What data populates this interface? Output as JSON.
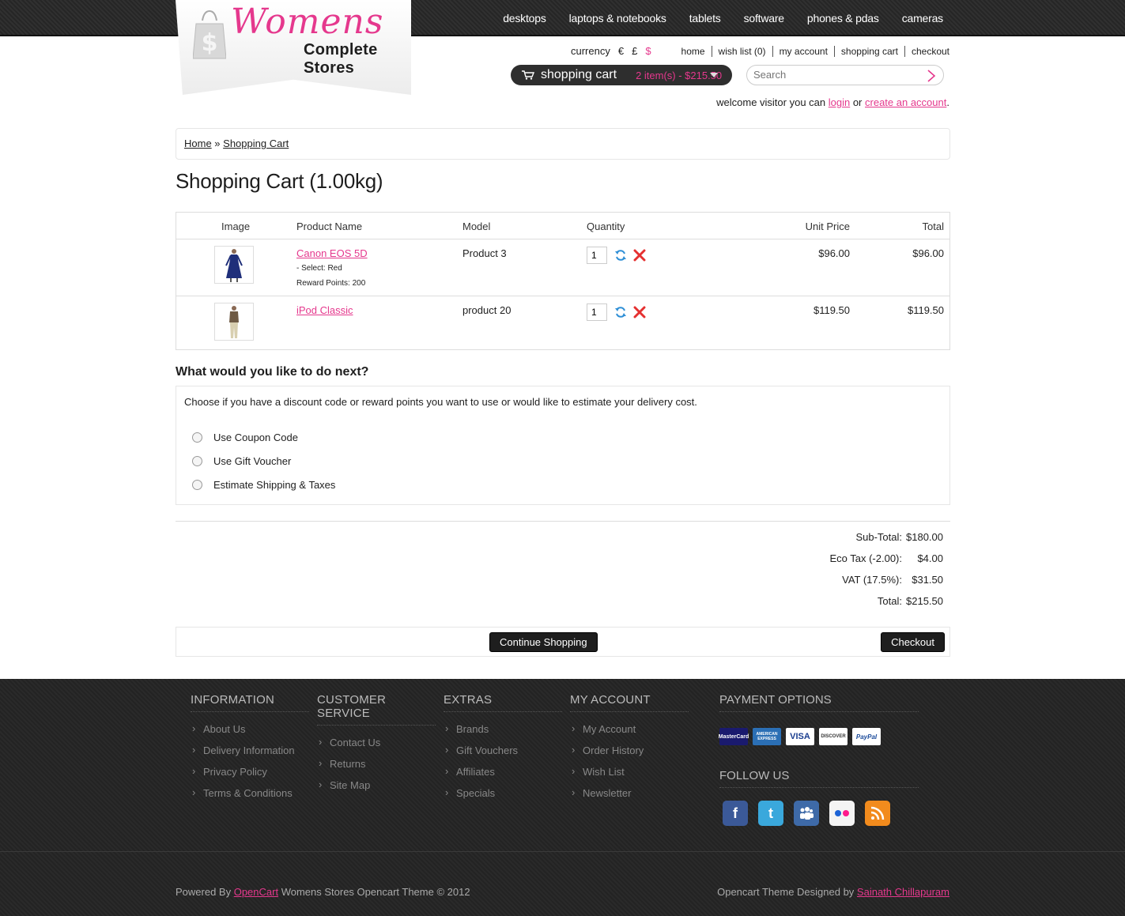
{
  "topnav": [
    "desktops",
    "laptops & notebooks",
    "tablets",
    "software",
    "phones & pdas",
    "cameras"
  ],
  "logo": {
    "brand": "Womens",
    "tagline": "Complete Stores"
  },
  "currency": {
    "label": "currency",
    "options": [
      "€",
      "£",
      "$"
    ],
    "selected": "$"
  },
  "toplinks": [
    "home",
    "wish list (0)",
    "my account",
    "shopping cart",
    "checkout"
  ],
  "cart": {
    "label": "shopping cart",
    "summary": "2 item(s) - $215.50"
  },
  "search": {
    "placeholder": "Search"
  },
  "welcome": {
    "prefix": "welcome visitor you can ",
    "login": "login",
    "or": " or ",
    "create": "create an account",
    "suffix": "."
  },
  "breadcrumb": {
    "home": "Home",
    "sep": " » ",
    "current": "Shopping Cart"
  },
  "page_title": "Shopping Cart  (1.00kg)",
  "table": {
    "headers": {
      "image": "Image",
      "name": "Product Name",
      "model": "Model",
      "quantity": "Quantity",
      "unit": "Unit Price",
      "total": "Total"
    },
    "rows": [
      {
        "name": "Canon EOS 5D",
        "options": [
          "- Select: Red",
          "Reward Points: 200"
        ],
        "model": "Product 3",
        "qty": "1",
        "unit": "$96.00",
        "total": "$96.00"
      },
      {
        "name": "iPod Classic",
        "options": [],
        "model": "product 20",
        "qty": "1",
        "unit": "$119.50",
        "total": "$119.50"
      }
    ]
  },
  "next": {
    "title": "What would you like to do next?",
    "intro": "Choose if you have a discount code or reward points you want to use or would like to estimate your delivery cost.",
    "options": [
      "Use Coupon Code",
      "Use Gift Voucher",
      "Estimate Shipping & Taxes"
    ]
  },
  "totals": [
    {
      "label": "Sub-Total:",
      "value": "$180.00"
    },
    {
      "label": "Eco Tax (-2.00):",
      "value": "$4.00"
    },
    {
      "label": "VAT (17.5%):",
      "value": "$31.50"
    },
    {
      "label": "Total:",
      "value": "$215.50"
    }
  ],
  "buttons": {
    "continue": "Continue Shopping",
    "checkout": "Checkout"
  },
  "footer": {
    "columns": [
      {
        "title": "INFORMATION",
        "items": [
          "About Us",
          "Delivery Information",
          "Privacy Policy",
          "Terms & Conditions"
        ]
      },
      {
        "title": "CUSTOMER SERVICE",
        "items": [
          "Contact Us",
          "Returns",
          "Site Map"
        ]
      },
      {
        "title": "EXTRAS",
        "items": [
          "Brands",
          "Gift Vouchers",
          "Affiliates",
          "Specials"
        ]
      },
      {
        "title": "MY ACCOUNT",
        "items": [
          "My Account",
          "Order History",
          "Wish List",
          "Newsletter"
        ]
      }
    ],
    "payment_title": "PAYMENT OPTIONS",
    "cards": [
      "MasterCard",
      "AMERICAN EXPRESS",
      "VISA",
      "DISCOVER",
      "PayPal"
    ],
    "follow_title": "FOLLOW US",
    "social": [
      "facebook-icon",
      "twitter-icon",
      "myspace-icon",
      "flickr-icon",
      "rss-icon"
    ],
    "powered": {
      "prefix": "Powered By ",
      "link": "OpenCart",
      "suffix": " Womens Stores Opencart Theme © 2012"
    },
    "designed": {
      "prefix": "Opencart Theme Designed by  ",
      "link": "Sainath Chillapuram"
    }
  },
  "colors": {
    "accent": "#e5388d",
    "dark": "#1e1e1e",
    "footer": "#262626"
  }
}
